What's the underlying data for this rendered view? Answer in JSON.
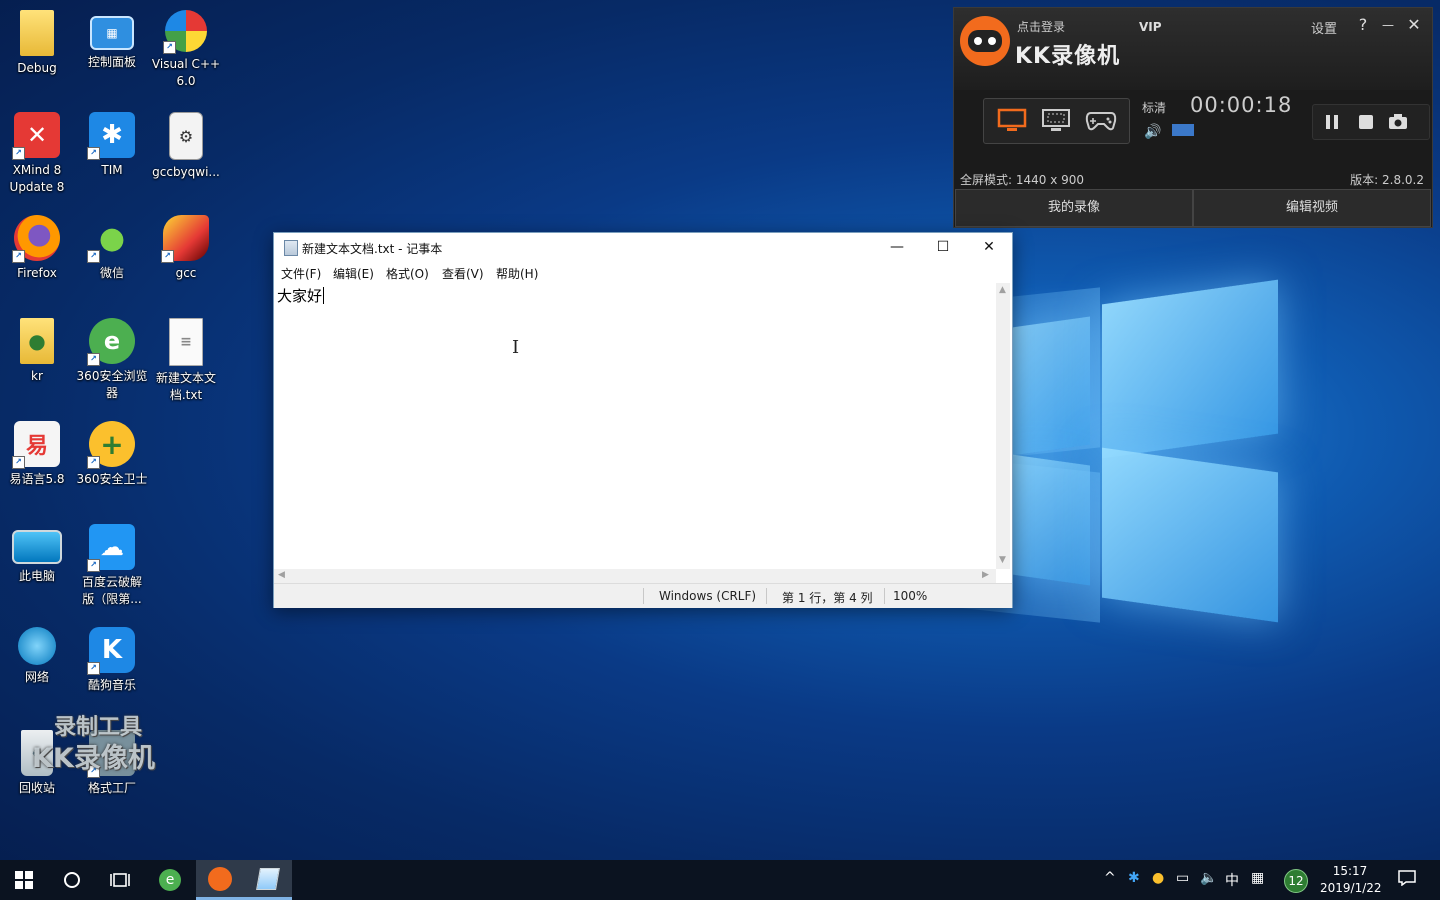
{
  "desktop": {
    "icons": [
      {
        "label": "Debug",
        "icon": "folder-icon"
      },
      {
        "label": "控制面板",
        "icon": "control-panel-icon"
      },
      {
        "label": "Visual C++\n6.0",
        "icon": "visual-cpp-icon"
      },
      {
        "label": "XMind 8\nUpdate 8",
        "icon": "xmind-icon"
      },
      {
        "label": "TIM",
        "icon": "tim-icon"
      },
      {
        "label": "gccbyqwi...",
        "icon": "file-icon"
      },
      {
        "label": "Firefox",
        "icon": "firefox-icon"
      },
      {
        "label": "微信",
        "icon": "wechat-icon"
      },
      {
        "label": "gcc",
        "icon": "gcc-icon"
      },
      {
        "label": "kr",
        "icon": "user-folder-icon"
      },
      {
        "label": "360安全浏览\n器",
        "icon": "browser-360-icon"
      },
      {
        "label": "新建文本文\n档.txt",
        "icon": "text-file-icon"
      },
      {
        "label": "易语言5.8",
        "icon": "eyuyan-icon"
      },
      {
        "label": "360安全卫士",
        "icon": "security-360-icon"
      },
      {
        "label": "此电脑",
        "icon": "this-pc-icon"
      },
      {
        "label": "百度云破解\n版（限第...",
        "icon": "baidu-cloud-icon"
      },
      {
        "label": "网络",
        "icon": "network-icon"
      },
      {
        "label": "酷狗音乐",
        "icon": "kugou-icon"
      },
      {
        "label": "回收站",
        "icon": "recycle-bin-icon"
      },
      {
        "label": "格式工厂",
        "icon": "format-factory-icon"
      }
    ],
    "watermark": {
      "line1": "录制工具",
      "line2": "KK录像机"
    }
  },
  "kk_recorder": {
    "login": "点击登录",
    "vip": "VIP",
    "brand": "KK录像机",
    "settings": "设置",
    "help": "?",
    "minimize": "—",
    "close": "✕",
    "quality": "标清",
    "timer": "00:00:18",
    "mode_info": "全屏模式: 1440 x 900",
    "version": "版本: 2.8.0.2",
    "my_recordings": "我的录像",
    "edit_video": "编辑视频",
    "accent_color": "#f26b1d"
  },
  "notepad": {
    "title": "新建文本文档.txt - 记事本",
    "menu": [
      "文件(F)",
      "编辑(E)",
      "格式(O)",
      "查看(V)",
      "帮助(H)"
    ],
    "content": "大家好",
    "status": {
      "encoding": "Windows (CRLF)",
      "position": "第 1 行，第 4 列",
      "zoom": "100%"
    }
  },
  "taskbar": {
    "time": "15:17",
    "date": "2019/1/22",
    "ime": "中",
    "notification_count": "12"
  }
}
